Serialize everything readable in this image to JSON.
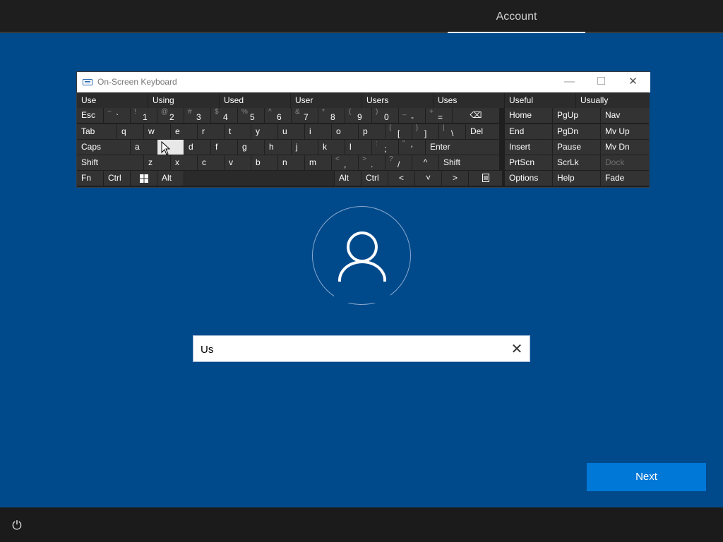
{
  "header": {
    "active_tab": "Account"
  },
  "osk": {
    "title": "On-Screen Keyboard",
    "window_controls": {
      "minimize": "—",
      "maximize": "☐",
      "close": "✕"
    },
    "predictions": [
      "Use",
      "Using",
      "Used",
      "User",
      "Users",
      "Uses",
      "Useful",
      "Usually"
    ],
    "row1": [
      {
        "label": "Esc"
      },
      {
        "sm": "~",
        "bg": "`"
      },
      {
        "sm": "!",
        "bg": "1"
      },
      {
        "sm": "@",
        "bg": "2"
      },
      {
        "sm": "#",
        "bg": "3"
      },
      {
        "sm": "$",
        "bg": "4"
      },
      {
        "sm": "%",
        "bg": "5"
      },
      {
        "sm": "^",
        "bg": "6"
      },
      {
        "sm": "&",
        "bg": "7"
      },
      {
        "sm": "*",
        "bg": "8"
      },
      {
        "sm": "(",
        "bg": "9"
      },
      {
        "sm": ")",
        "bg": "0"
      },
      {
        "sm": "_",
        "bg": "-"
      },
      {
        "sm": "+",
        "bg": "="
      },
      {
        "label": "⌫"
      }
    ],
    "row2": [
      "Tab",
      "q",
      "w",
      "e",
      "r",
      "t",
      "y",
      "u",
      "i",
      "o",
      "p",
      "{[",
      "}]",
      "|\\",
      "Del"
    ],
    "row2_sym": [
      {
        "sm": "{",
        "bg": "["
      },
      {
        "sm": "}",
        "bg": "]"
      },
      {
        "sm": "|",
        "bg": "\\"
      }
    ],
    "row3": [
      "Caps",
      "a",
      "s",
      "d",
      "f",
      "g",
      "h",
      "j",
      "k",
      "l",
      "Enter"
    ],
    "row3_sym": [
      {
        "sm": ":",
        "bg": ";"
      },
      {
        "sm": "\"",
        "bg": "'"
      }
    ],
    "row4": [
      "Shift",
      "z",
      "x",
      "c",
      "v",
      "b",
      "n",
      "m",
      "Shift"
    ],
    "row4_sym": [
      {
        "sm": "<",
        "bg": ","
      },
      {
        "sm": ">",
        "bg": "."
      },
      {
        "sm": "?",
        "bg": "/"
      }
    ],
    "row4_arrow": "^",
    "row5": {
      "fn": "Fn",
      "ctrl": "Ctrl",
      "alt": "Alt",
      "alt_r": "Alt",
      "ctrl_r": "Ctrl",
      "left": "<",
      "down": "˅",
      "right": ">"
    },
    "nav_keys": [
      [
        "Home",
        "PgUp",
        "Nav"
      ],
      [
        "End",
        "PgDn",
        "Mv Up"
      ],
      [
        "Insert",
        "Pause",
        "Mv Dn"
      ],
      [
        "PrtScn",
        "ScrLk",
        "Dock"
      ],
      [
        "Options",
        "Help",
        "Fade"
      ]
    ]
  },
  "account_input": {
    "value": "Us",
    "clear_icon": "✕"
  },
  "next_button": {
    "label": "Next"
  },
  "ease_of_access_icon": "⏻"
}
